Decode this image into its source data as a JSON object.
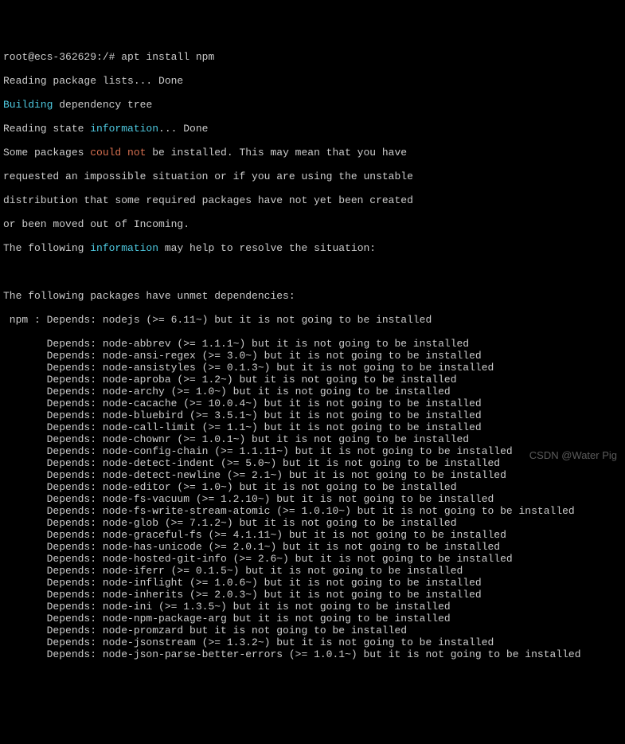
{
  "prompt": "root@ecs-362629:/# apt install npm",
  "l1": "Reading package lists... Done",
  "building": "Building",
  "l2b": " dependency tree",
  "l3a": "Reading state ",
  "information": "information",
  "l3b": "... Done",
  "l4a": "Some packages ",
  "couldnot": "could not",
  "l4b": " be installed. This may mean that you have",
  "l5": "requested an impossible situation or if you are using the unstable",
  "l6": "distribution that some required packages have not yet been created",
  "l7": "or been moved out of Incoming.",
  "l8a": "The following ",
  "l8b": " may help to resolve the situation:",
  "l9": "The following packages have unmet dependencies:",
  "l10": " npm : Depends: nodejs (>= 6.11~) but it is not going to be installed",
  "deps": [
    "Depends: node-abbrev (>= 1.1.1~) but it is not going to be installed",
    "Depends: node-ansi-regex (>= 3.0~) but it is not going to be installed",
    "Depends: node-ansistyles (>= 0.1.3~) but it is not going to be installed",
    "Depends: node-aproba (>= 1.2~) but it is not going to be installed",
    "Depends: node-archy (>= 1.0~) but it is not going to be installed",
    "Depends: node-cacache (>= 10.0.4~) but it is not going to be installed",
    "Depends: node-bluebird (>= 3.5.1~) but it is not going to be installed",
    "Depends: node-call-limit (>= 1.1~) but it is not going to be installed",
    "Depends: node-chownr (>= 1.0.1~) but it is not going to be installed",
    "Depends: node-config-chain (>= 1.1.11~) but it is not going to be installed",
    "Depends: node-detect-indent (>= 5.0~) but it is not going to be installed",
    "Depends: node-detect-newline (>= 2.1~) but it is not going to be installed",
    "Depends: node-editor (>= 1.0~) but it is not going to be installed",
    "Depends: node-fs-vacuum (>= 1.2.10~) but it is not going to be installed",
    "Depends: node-fs-write-stream-atomic (>= 1.0.10~) but it is not going to be installed",
    "Depends: node-glob (>= 7.1.2~) but it is not going to be installed",
    "Depends: node-graceful-fs (>= 4.1.11~) but it is not going to be installed",
    "Depends: node-has-unicode (>= 2.0.1~) but it is not going to be installed",
    "Depends: node-hosted-git-info (>= 2.6~) but it is not going to be installed",
    "Depends: node-iferr (>= 0.1.5~) but it is not going to be installed",
    "Depends: node-inflight (>= 1.0.6~) but it is not going to be installed",
    "Depends: node-inherits (>= 2.0.3~) but it is not going to be installed",
    "Depends: node-ini (>= 1.3.5~) but it is not going to be installed",
    "Depends: node-npm-package-arg but it is not going to be installed",
    "Depends: node-promzard but it is not going to be installed",
    "Depends: node-jsonstream (>= 1.3.2~) but it is not going to be installed",
    "Depends: node-json-parse-better-errors (>= 1.0.1~) but it is not going to be installed"
  ],
  "watermark": "CSDN @Water Pig"
}
